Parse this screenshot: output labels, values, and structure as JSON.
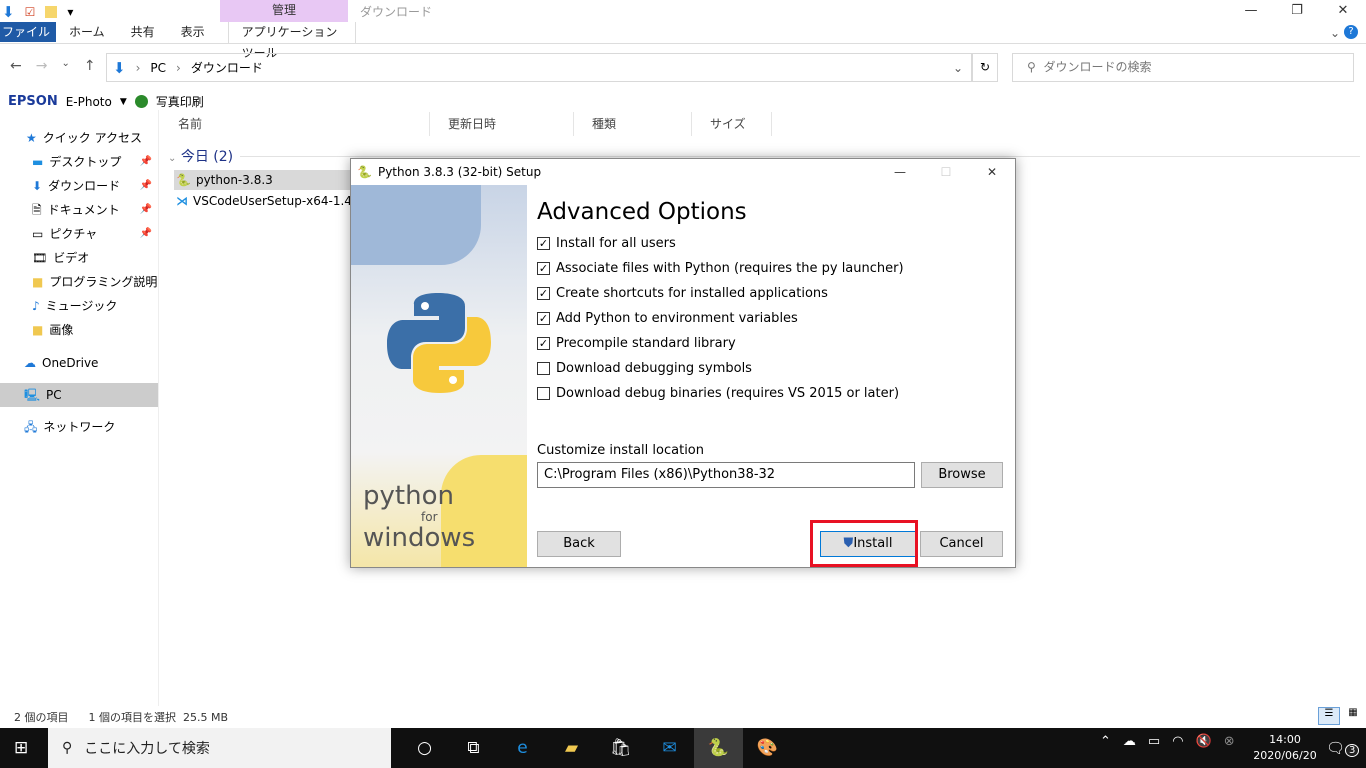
{
  "explorer": {
    "ribbon": {
      "context_group": "管理",
      "window_title": "ダウンロード",
      "tabs": [
        "ファイル",
        "ホーム",
        "共有",
        "表示",
        "アプリケーション ツール"
      ]
    },
    "address": {
      "path": [
        "PC",
        "ダウンロード"
      ],
      "search_placeholder": "ダウンロードの検索"
    },
    "epson": {
      "brand": "EPSON",
      "app": "E-Photo",
      "print": "写真印刷"
    },
    "sidebar": {
      "quick_access": "クイック アクセス",
      "items": [
        "デスクトップ",
        "ダウンロード",
        "ドキュメント",
        "ピクチャ",
        "ビデオ",
        "プログラミング説明",
        "ミュージック",
        "画像"
      ],
      "onedrive": "OneDrive",
      "pc": "PC",
      "network": "ネットワーク"
    },
    "columns": [
      "名前",
      "更新日時",
      "種類",
      "サイズ"
    ],
    "group": "今日 (2)",
    "files": [
      "python-3.8.3",
      "VSCodeUserSetup-x64-1.46.1"
    ],
    "status": {
      "count": "2 個の項目",
      "selected": "1 個の項目を選択",
      "size": "25.5 MB"
    }
  },
  "dialog": {
    "title": "Python 3.8.3 (32-bit) Setup",
    "heading": "Advanced Options",
    "options": [
      {
        "label": "Install for all users",
        "checked": true
      },
      {
        "label": "Associate files with Python (requires the py launcher)",
        "checked": true
      },
      {
        "label": "Create shortcuts for installed applications",
        "checked": true
      },
      {
        "label": "Add Python to environment variables",
        "checked": true
      },
      {
        "label": "Precompile standard library",
        "checked": true
      },
      {
        "label": "Download debugging symbols",
        "checked": false
      },
      {
        "label": "Download debug binaries (requires VS 2015 or later)",
        "checked": false
      }
    ],
    "location_label": "Customize install location",
    "location_value": "C:\\Program Files (x86)\\Python38-32",
    "browse": "Browse",
    "back": "Back",
    "install": "Install",
    "cancel": "Cancel",
    "banner": {
      "python": "python",
      "for": "for",
      "windows": "windows"
    },
    "highlight_color": "#e81123"
  },
  "taskbar": {
    "search_placeholder": "ここに入力して検索",
    "time": "14:00",
    "date": "2020/06/20",
    "notifications": "3"
  }
}
